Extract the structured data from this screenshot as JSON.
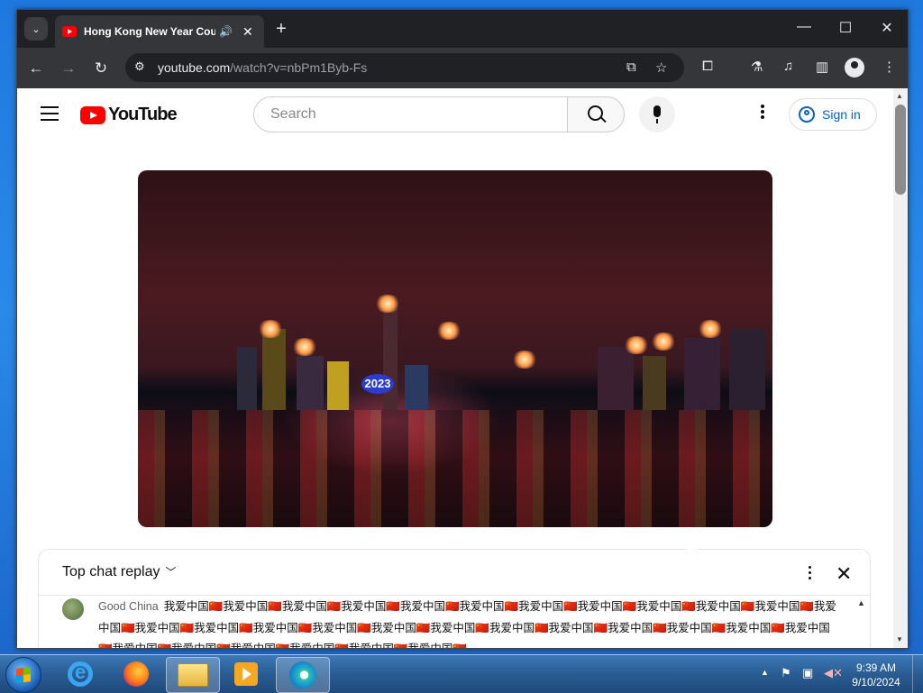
{
  "browser": {
    "tab": {
      "title": "Hong Kong New Year Coun",
      "audio_icon": "🔊",
      "close": "✕"
    },
    "new_tab": "+",
    "window_controls": {
      "minimize": "—",
      "maximize": "☐",
      "close": "✕"
    },
    "nav": {
      "back": "←",
      "forward": "→",
      "reload": "↻"
    },
    "url_host": "youtube.com",
    "url_path": "/watch?v=nbPm1Byb-Fs"
  },
  "youtube": {
    "logo_text": "YouTube",
    "search_placeholder": "Search",
    "signin_label": "Sign in",
    "chat": {
      "title": "Top chat replay",
      "author": "Good China",
      "message": "我爱中国🇨🇳我爱中国🇨🇳我爱中国🇨🇳我爱中国🇨🇳我爱中国🇨🇳我爱中国🇨🇳我爱中国🇨🇳我爱中国🇨🇳我爱中国🇨🇳我爱中国🇨🇳我爱中国🇨🇳我爱中国🇨🇳我爱中国🇨🇳我爱中国🇨🇳我爱中国🇨🇳我爱中国🇨🇳我爱中国🇨🇳我爱中国🇨🇳我爱中国🇨🇳我爱中国🇨🇳我爱中国🇨🇳我爱中国🇨🇳我爱中国🇨🇳我爱中国🇨🇳我爱中国🇨🇳我爱中国🇨🇳我爱中国🇨🇳我爱中国🇨🇳我爱中国🇨🇳我爱中国🇨🇳"
    },
    "video_overlay_text": "2023"
  },
  "taskbar": {
    "clock_time": "9:39 AM",
    "clock_date": "9/10/2024"
  },
  "icons": [
    "tab-search-icon",
    "youtube-favicon-icon",
    "audio-icon",
    "site-info-icon",
    "install-app-icon",
    "bookmark-star-icon",
    "extensions-icon",
    "labs-icon",
    "media-control-icon",
    "side-panel-icon",
    "profile-icon",
    "menu-icon",
    "hamburger-icon",
    "search-icon",
    "mic-icon",
    "user-icon",
    "chevron-down-icon",
    "close-icon",
    "windows-start-icon",
    "internet-explorer-icon",
    "firefox-icon",
    "file-explorer-icon",
    "media-player-icon",
    "edge-icon",
    "flag-icon",
    "network-icon",
    "volume-muted-icon"
  ]
}
